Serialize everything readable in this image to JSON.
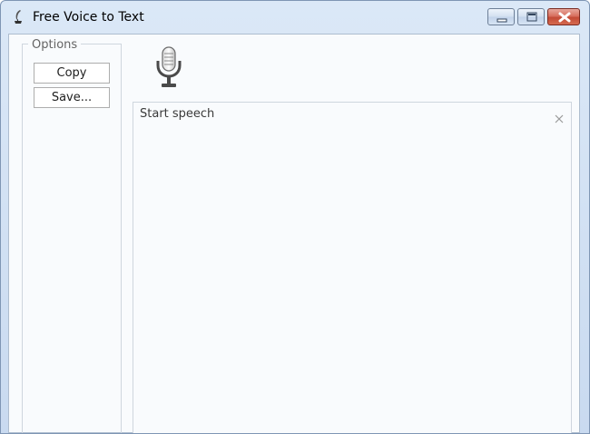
{
  "window": {
    "title": "Free Voice to Text",
    "icons": {
      "app": "quill-icon",
      "minimize": "minimize-icon",
      "maximize": "maximize-icon",
      "close": "close-icon"
    },
    "colors": {
      "titlebar": "#c9daf0",
      "close_button": "#c34a36",
      "client_bg": "#f9fbfd"
    }
  },
  "options": {
    "legend": "Options",
    "copy_label": "Copy",
    "save_label": "Save..."
  },
  "main": {
    "mic_icon": "microphone-icon",
    "speech_text": "Start speech",
    "clear_icon": "close-icon"
  }
}
